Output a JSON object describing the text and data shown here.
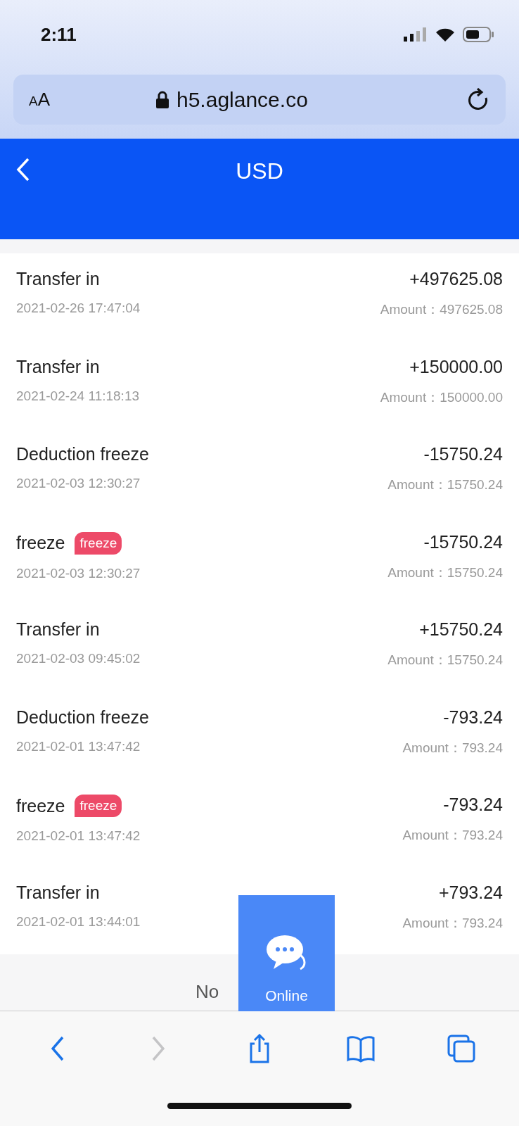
{
  "status_bar": {
    "time": "2:11"
  },
  "address_bar": {
    "text_size_letters": [
      "A",
      "A"
    ],
    "url": "h5.aglance.co"
  },
  "header": {
    "title": "USD"
  },
  "transactions": [
    {
      "title": "Transfer in",
      "date": "2021-02-26 17:47:04",
      "change": "+497625.08",
      "amount": "Amount：497625.08"
    },
    {
      "title": "Transfer in",
      "date": "2021-02-24 11:18:13",
      "change": "+150000.00",
      "amount": "Amount：150000.00"
    },
    {
      "title": "Deduction freeze",
      "date": "2021-02-03 12:30:27",
      "change": "-15750.24",
      "amount": "Amount：15750.24"
    },
    {
      "title": "freeze",
      "badge": "freeze",
      "date": "2021-02-03 12:30:27",
      "change": "-15750.24",
      "amount": "Amount：15750.24"
    },
    {
      "title": "Transfer in",
      "date": "2021-02-03 09:45:02",
      "change": "+15750.24",
      "amount": "Amount：15750.24"
    },
    {
      "title": "Deduction freeze",
      "date": "2021-02-01 13:47:42",
      "change": "-793.24",
      "amount": "Amount：793.24"
    },
    {
      "title": "freeze",
      "badge": "freeze",
      "date": "2021-02-01 13:47:42",
      "change": "-793.24",
      "amount": "Amount：793.24"
    },
    {
      "title": "Transfer in",
      "date": "2021-02-01 13:44:01",
      "change": "+793.24",
      "amount": "Amount：793.24"
    }
  ],
  "end_note": "No",
  "chat_button": {
    "label": "Online"
  },
  "toolbar": [
    {
      "kind": "back",
      "disabled": false
    },
    {
      "kind": "forward",
      "disabled": true
    },
    {
      "kind": "share",
      "disabled": false
    },
    {
      "kind": "bookmarks",
      "disabled": false
    },
    {
      "kind": "tabs",
      "disabled": false
    }
  ]
}
